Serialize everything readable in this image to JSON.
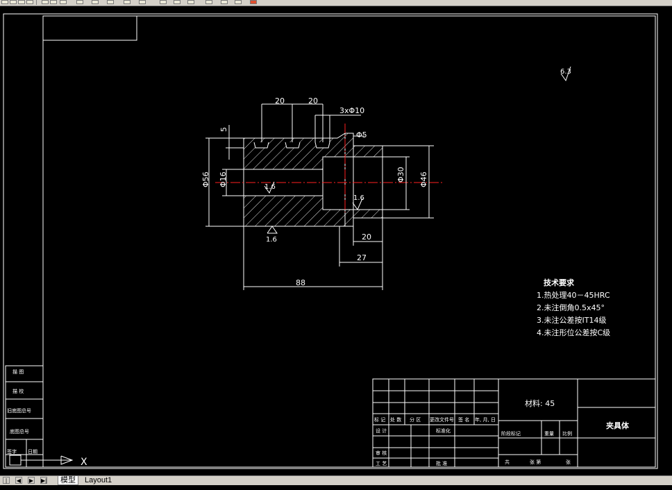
{
  "tabs": {
    "model": "模型",
    "layout1": "Layout1"
  },
  "nav": {
    "first": "|◀",
    "prev": "◀",
    "next": "▶",
    "last": "▶|"
  },
  "dims": {
    "d20a": "20",
    "d20b": "20",
    "holes": "3xΦ10",
    "d5": "5",
    "phi5": "Φ5",
    "phi56": "Φ56",
    "phi16": "Φ16",
    "phi30": "Φ30",
    "phi46": "Φ46",
    "d20c": "20",
    "d27": "27",
    "d88": "88",
    "r16a": "1.6",
    "r16b": "1.6",
    "r16c": "1.6",
    "r63": "6.3"
  },
  "notes": {
    "title": "技术要求",
    "n1": "1.热处理40－45HRC",
    "n2": "2.未注倒角0.5x45°",
    "n3": "3.未注公差按IT14级",
    "n4": "4.未注形位公差按C级"
  },
  "title_block": {
    "material": "材料: 45",
    "part_name": "夹具体",
    "h_mark": "标 记",
    "h_count": "处 数",
    "h_zone": "分 区",
    "h_doc": "更改文件号",
    "h_sign": "签 名",
    "h_date": "年, 月, 日",
    "design": "设 计",
    "standard": "标准化",
    "review": "审 核",
    "process": "工 艺",
    "approve": "批 准",
    "stage": "阶段标记",
    "weight": "重量",
    "scale": "比例",
    "total": "共",
    "sheet": "张 第",
    "sheet_end": "张"
  },
  "side_block": {
    "r1": "描 图",
    "r2": "描 校",
    "r3": "旧底图总号",
    "r4": "底图总号",
    "r5": "签字",
    "r6": "日期"
  },
  "ucs": {
    "x_label": "X"
  },
  "colors": {
    "background": "#000000",
    "lines": "#ffffff",
    "centerline": "#ff2020",
    "chrome": "#d4d0c8"
  }
}
